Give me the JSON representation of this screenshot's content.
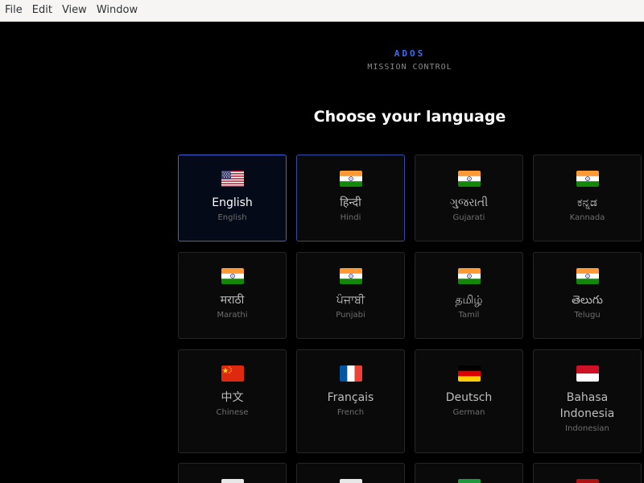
{
  "menubar": {
    "items": [
      {
        "label": "File"
      },
      {
        "label": "Edit"
      },
      {
        "label": "View"
      },
      {
        "label": "Window"
      }
    ]
  },
  "brand": {
    "name": "ADOS",
    "subtitle": "MISSION CONTROL"
  },
  "page": {
    "title": "Choose your language"
  },
  "languages": [
    {
      "native": "English",
      "english": "English",
      "flag": "us-flag-icon",
      "state": "selected"
    },
    {
      "native": "हिन्दी",
      "english": "Hindi",
      "flag": "india-flag-icon",
      "state": "hovered"
    },
    {
      "native": "ગુજરાતી",
      "english": "Gujarati",
      "flag": "india-flag-icon",
      "state": ""
    },
    {
      "native": "ಕನ್ನಡ",
      "english": "Kannada",
      "flag": "india-flag-icon",
      "state": ""
    },
    {
      "native": "मराठी",
      "english": "Marathi",
      "flag": "india-flag-icon",
      "state": ""
    },
    {
      "native": "ਪੰਜਾਬੀ",
      "english": "Punjabi",
      "flag": "india-flag-icon",
      "state": ""
    },
    {
      "native": "தமிழ்",
      "english": "Tamil",
      "flag": "india-flag-icon",
      "state": ""
    },
    {
      "native": "తెలుగు",
      "english": "Telugu",
      "flag": "india-flag-icon",
      "state": ""
    },
    {
      "native": "中文",
      "english": "Chinese",
      "flag": "china-flag-icon",
      "state": ""
    },
    {
      "native": "Français",
      "english": "French",
      "flag": "france-flag-icon",
      "state": ""
    },
    {
      "native": "Deutsch",
      "english": "German",
      "flag": "germany-flag-icon",
      "state": ""
    },
    {
      "native": "Bahasa Indonesia",
      "english": "Indonesian",
      "flag": "indonesia-flag-icon",
      "state": ""
    }
  ],
  "colors": {
    "accent": "#3b6ef5",
    "selected_border": "#3a63d8",
    "card_background": "#0a0a0a",
    "card_border": "#262626"
  }
}
